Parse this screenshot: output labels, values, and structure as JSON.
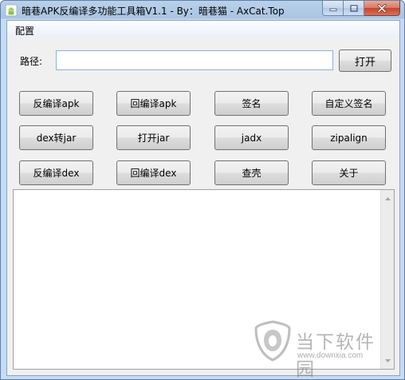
{
  "window": {
    "title": "暗巷APK反编译多功能工具箱V1.1 - By：暗巷猫 - AxCat.Top"
  },
  "menu": {
    "items": [
      "配置"
    ]
  },
  "path": {
    "label": "路径:",
    "value": "",
    "open_label": "打开"
  },
  "buttons": {
    "rows": [
      [
        "反编译apk",
        "回编译apk",
        "签名",
        "自定义签名"
      ],
      [
        "dex转jar",
        "打开jar",
        "jadx",
        "zipalign"
      ],
      [
        "反编译dex",
        "回编译dex",
        "查壳",
        "关于"
      ]
    ]
  },
  "log": {
    "text": ""
  },
  "watermark": {
    "title": "当下软件园",
    "url": "www.downxia.com"
  },
  "icons": {
    "app": "android-icon",
    "minimize": "minimize-icon",
    "maximize": "maximize-icon",
    "close": "close-icon",
    "scroll_up": "arrow-up-icon",
    "scroll_down": "arrow-down-icon"
  },
  "colors": {
    "title_bar": "#b9d1ea",
    "close_button": "#c4452b",
    "input_border": "#8fb0d8",
    "client_bg": "#f0f0f0"
  }
}
